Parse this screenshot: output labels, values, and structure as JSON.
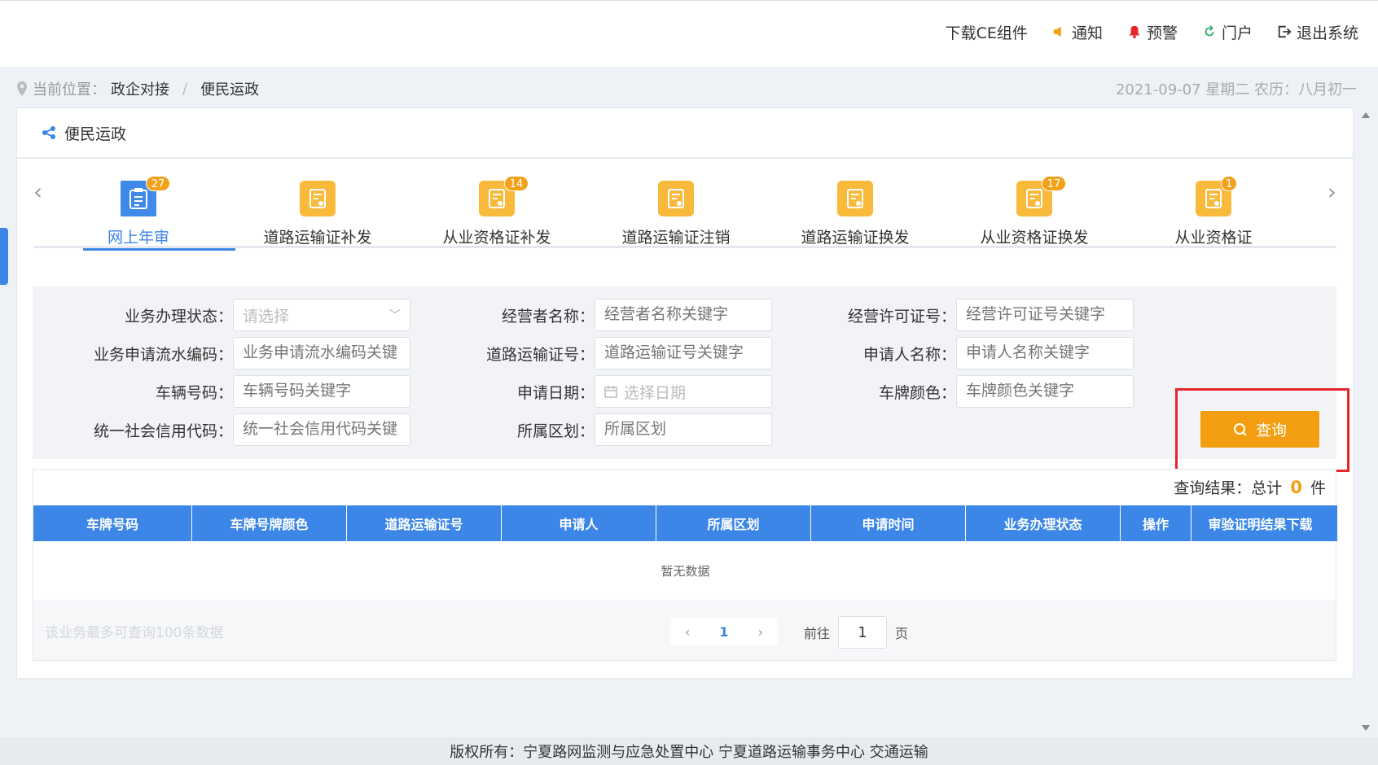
{
  "topnav": {
    "download": "下载CE组件",
    "notice": "通知",
    "alert": "预警",
    "portal": "门户",
    "logout": "退出系统"
  },
  "breadcrumb": {
    "prefix": "当前位置：",
    "level1": "政企对接",
    "separator": "/",
    "level2": "便民运政",
    "date": "2021-09-07 星期二 农历：八月初一"
  },
  "panel": {
    "title": "便民运政"
  },
  "tabs": [
    {
      "label": "网上年审",
      "badge": "27"
    },
    {
      "label": "道路运输证补发",
      "badge": ""
    },
    {
      "label": "从业资格证补发",
      "badge": "14"
    },
    {
      "label": "道路运输证注销",
      "badge": ""
    },
    {
      "label": "道路运输证换发",
      "badge": ""
    },
    {
      "label": "从业资格证换发",
      "badge": "17"
    },
    {
      "label": "从业资格证",
      "badge": "1"
    }
  ],
  "filters": {
    "status": {
      "label": "业务办理状态：",
      "placeholder": "请选择"
    },
    "operator_name": {
      "label": "经营者名称：",
      "placeholder": "经营者名称关键字"
    },
    "license_no": {
      "label": "经营许可证号：",
      "placeholder": "经营许可证号关键字"
    },
    "serial_no": {
      "label": "业务申请流水编码：",
      "placeholder": "业务申请流水编码关键"
    },
    "transport_cert": {
      "label": "道路运输证号：",
      "placeholder": "道路运输证号关键字"
    },
    "applicant": {
      "label": "申请人名称：",
      "placeholder": "申请人名称关键字"
    },
    "vehicle_no": {
      "label": "车辆号码：",
      "placeholder": "车辆号码关键字"
    },
    "apply_date": {
      "label": "申请日期：",
      "placeholder": "选择日期"
    },
    "plate_color": {
      "label": "车牌颜色：",
      "placeholder": "车牌颜色关键字"
    },
    "credit_code": {
      "label": "统一社会信用代码：",
      "placeholder": "统一社会信用代码关键"
    },
    "district": {
      "label": "所属区划：",
      "placeholder": "所属区划"
    }
  },
  "query_button": "查询",
  "results": {
    "count_prefix": "查询结果：总计",
    "count": "0",
    "count_suffix": "件",
    "columns": [
      "车牌号码",
      "车牌号牌颜色",
      "道路运输证号",
      "申请人",
      "所属区划",
      "申请时间",
      "业务办理状态",
      "操作",
      "审验证明结果下载"
    ],
    "empty_text": "暂无数据",
    "note": "该业务最多可查询100条数据",
    "current_page": "1",
    "goto_prefix": "前往",
    "goto_value": "1",
    "goto_suffix": "页"
  },
  "footer": "版权所有：宁夏路网监测与应急处置中心 宁夏道路运输事务中心 交通运输"
}
